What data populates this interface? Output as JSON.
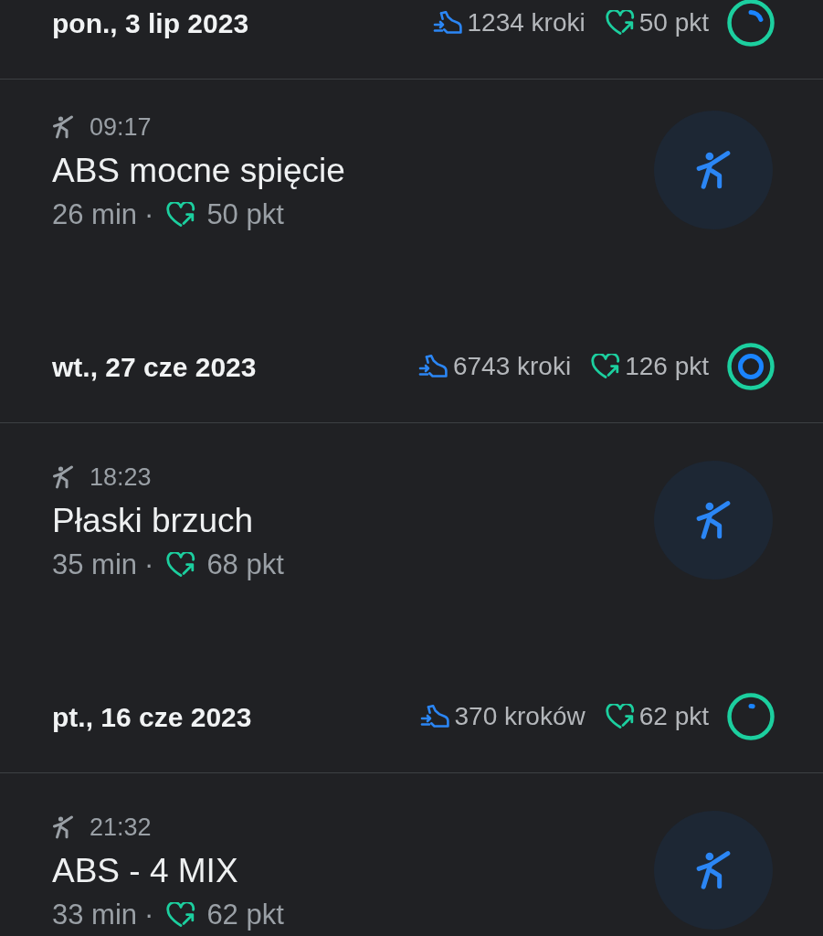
{
  "days": [
    {
      "date": "pon., 3 lip 2023",
      "steps": "1234 kroki",
      "heart_points": "50 pkt",
      "goal_ring": {
        "outer": {
          "level": 1
        },
        "inner": {
          "level": 0.2
        }
      },
      "activities": [
        {
          "time": "09:17",
          "title": "ABS mocne spięcie",
          "duration": "26 min",
          "separator": "·",
          "heart_points": "50 pkt"
        }
      ]
    },
    {
      "date": "wt., 27 cze 2023",
      "steps": "6743 kroki",
      "heart_points": "126 pkt",
      "goal_ring": {
        "outer": {
          "level": 1
        },
        "inner": {
          "level": 1
        }
      },
      "activities": [
        {
          "time": "18:23",
          "title": "Płaski brzuch",
          "duration": "35 min",
          "separator": "·",
          "heart_points": "68 pkt"
        }
      ]
    },
    {
      "date": "pt., 16 cze 2023",
      "steps": "370 kroków",
      "heart_points": "62 pkt",
      "goal_ring": {
        "outer": {
          "level": 1
        },
        "inner": {
          "level": 0.03
        }
      },
      "activities": [
        {
          "time": "21:32",
          "title": "ABS - 4 MIX",
          "duration": "33 min",
          "separator": "·",
          "heart_points": "62 pkt"
        }
      ]
    }
  ]
}
